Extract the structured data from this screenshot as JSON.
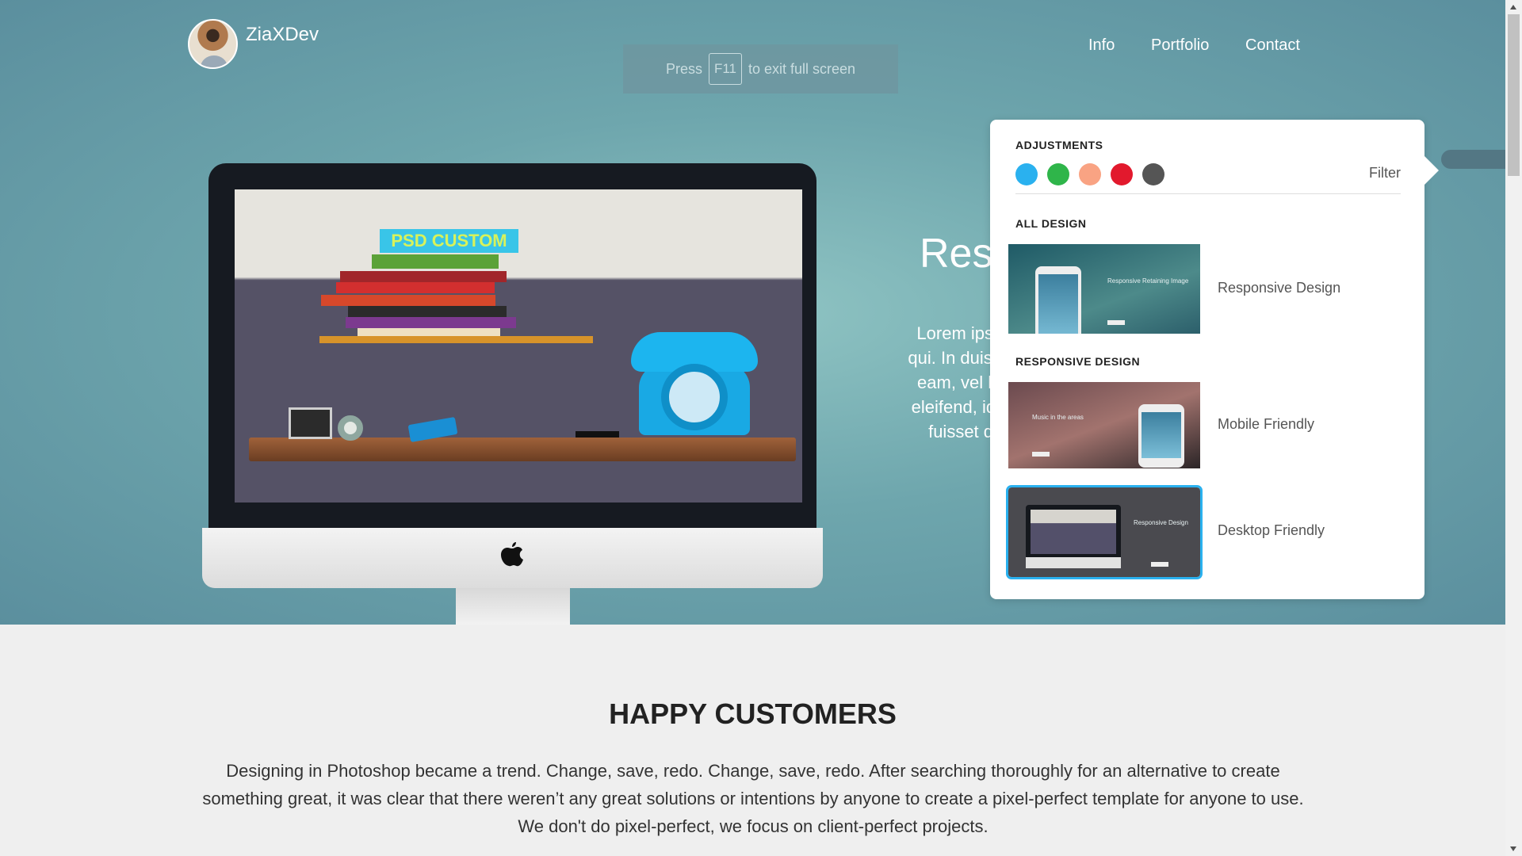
{
  "brand": {
    "name": "ZiaXDev"
  },
  "fullscreen_notice": {
    "before": "Press",
    "key": "F11",
    "after": "to exit full screen"
  },
  "nav": {
    "items": [
      "Info",
      "Portfolio",
      "Contact"
    ]
  },
  "monitor_screen": {
    "book_tag": "PSD CUSTOM"
  },
  "hero": {
    "title": "Res",
    "text_lines": [
      "Lorem ipsum",
      "qui. In duis pau",
      "eam, vel hab",
      "eleifend, id his",
      "fuisset dis"
    ]
  },
  "panel": {
    "adjustments_title": "ADJUSTMENTS",
    "colors": [
      "#2ab1ef",
      "#2fb54a",
      "#f9a383",
      "#e2192d",
      "#555555"
    ],
    "filter_label": "Filter",
    "all_design_title": "ALL DESIGN",
    "responsive_design_title": "RESPONSIVE DESIGN",
    "items": [
      {
        "label": "Responsive Design",
        "thumb_text": "Responsive Retaining Image"
      },
      {
        "label": "Mobile Friendly",
        "thumb_text": "Music in the areas"
      },
      {
        "label": "Desktop Friendly",
        "thumb_text": "Responsive Design",
        "selected": true
      }
    ]
  },
  "happy_customers": {
    "title": "HAPPY CUSTOMERS",
    "lines": [
      "Designing in Photoshop became a trend. Change, save, redo. Change, save, redo. After searching thoroughly for an alternative to create",
      "something great, it was clear that there weren’t any great solutions or intentions by anyone to create a pixel-perfect template for anyone to use.",
      "We don't do pixel-perfect, we focus on client-perfect projects."
    ]
  }
}
